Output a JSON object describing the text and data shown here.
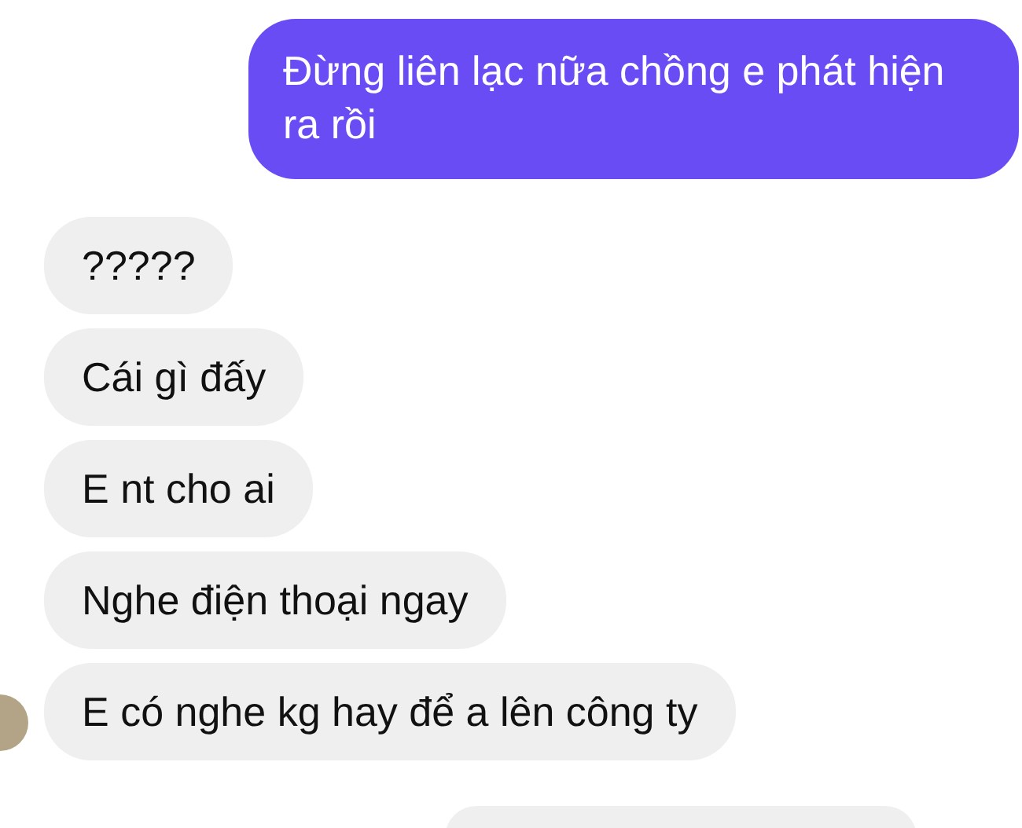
{
  "messages": [
    {
      "kind": "outgoing",
      "text": "Đừng liên lạc nữa chồng e phát hiện ra rồi",
      "avatar": false
    },
    {
      "kind": "incoming",
      "text": "?????",
      "avatar": false
    },
    {
      "kind": "incoming",
      "text": "Cái gì đấy",
      "avatar": false
    },
    {
      "kind": "incoming",
      "text": "E nt cho ai",
      "avatar": false
    },
    {
      "kind": "incoming",
      "text": "Nghe điện thoại ngay",
      "avatar": false
    },
    {
      "kind": "incoming",
      "text": "E có nghe kg hay để a lên công ty",
      "avatar": true
    }
  ]
}
